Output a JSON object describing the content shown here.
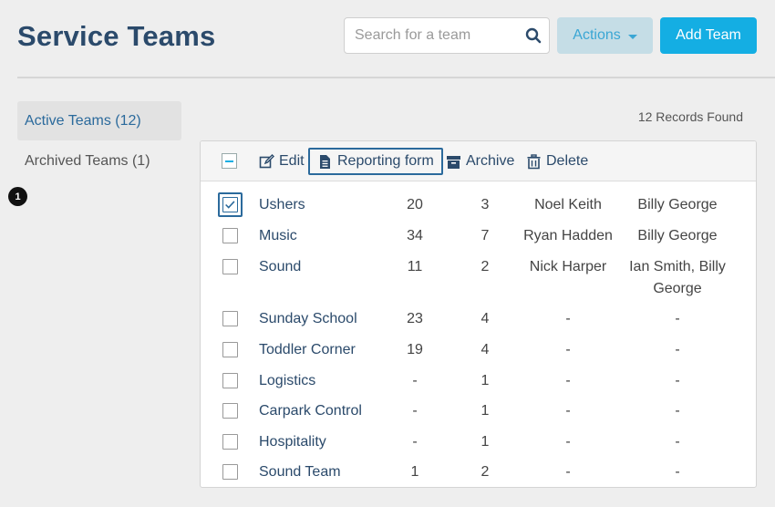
{
  "header": {
    "title": "Service Teams",
    "search_placeholder": "Search for a team",
    "actions_label": "Actions",
    "add_label": "Add Team"
  },
  "sidebar": {
    "items": [
      {
        "label": "Active Teams (12)",
        "active": true
      },
      {
        "label": "Archived Teams (1)",
        "active": false
      }
    ],
    "badge": "1"
  },
  "records_found": "12 Records Found",
  "toolbar": {
    "edit_label": "Edit",
    "reporting_label": "Reporting form",
    "archive_label": "Archive",
    "delete_label": "Delete"
  },
  "teams": [
    {
      "name": "Ushers",
      "col1": "20",
      "col2": "3",
      "col3": "Noel Keith",
      "col4": "Billy George",
      "checked": true
    },
    {
      "name": "Music",
      "col1": "34",
      "col2": "7",
      "col3": "Ryan Hadden",
      "col4": "Billy George",
      "checked": false
    },
    {
      "name": "Sound",
      "col1": "11",
      "col2": "2",
      "col3": "Nick Harper",
      "col4": "Ian Smith, Billy George",
      "checked": false
    },
    {
      "name": "Sunday School",
      "col1": "23",
      "col2": "4",
      "col3": "-",
      "col4": "-",
      "checked": false
    },
    {
      "name": "Toddler Corner",
      "col1": "19",
      "col2": "4",
      "col3": "-",
      "col4": "-",
      "checked": false
    },
    {
      "name": "Logistics",
      "col1": "-",
      "col2": "1",
      "col3": "-",
      "col4": "-",
      "checked": false
    },
    {
      "name": "Carpark Control",
      "col1": "-",
      "col2": "1",
      "col3": "-",
      "col4": "-",
      "checked": false
    },
    {
      "name": "Hospitality",
      "col1": "-",
      "col2": "1",
      "col3": "-",
      "col4": "-",
      "checked": false
    },
    {
      "name": "Sound Team",
      "col1": "1",
      "col2": "2",
      "col3": "-",
      "col4": "-",
      "checked": false
    }
  ],
  "colors": {
    "accent": "#14aee3",
    "title": "#2b4a6b",
    "focus": "#2b6a9c"
  }
}
